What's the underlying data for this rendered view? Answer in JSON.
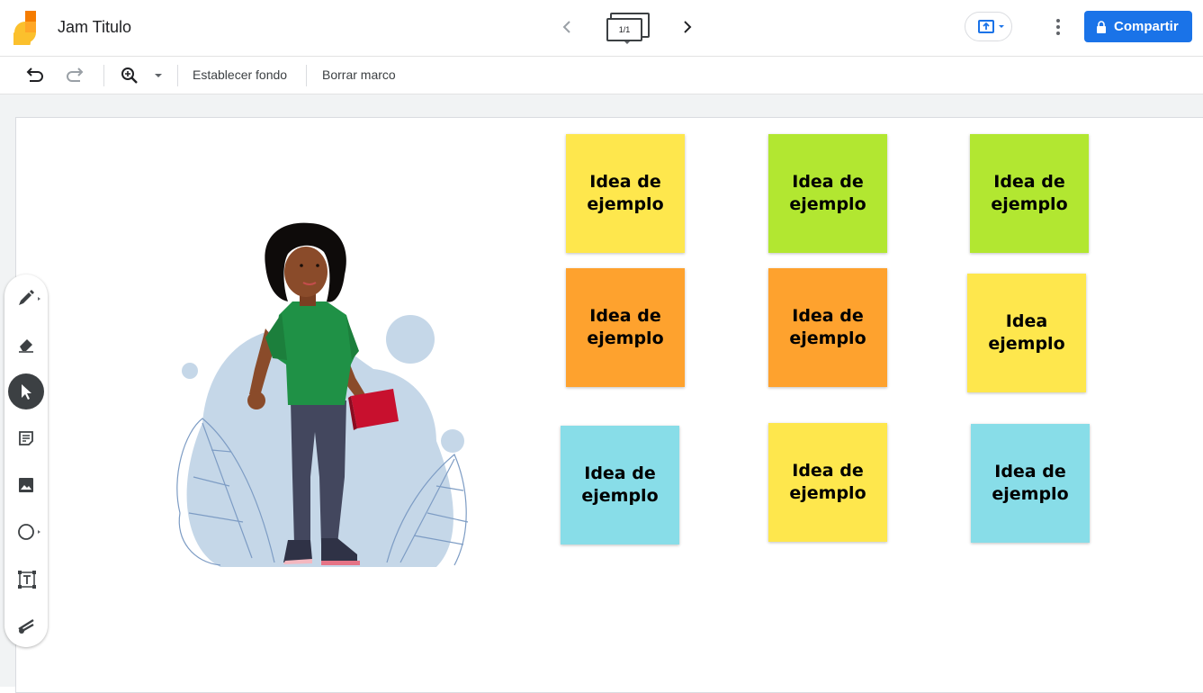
{
  "app": {
    "title": "Jam Titulo"
  },
  "nav": {
    "frame_indicator": "1/1"
  },
  "header": {
    "share_label": "Compartir"
  },
  "toolbar": {
    "set_background_label": "Establecer fondo",
    "clear_frame_label": "Borrar marco"
  },
  "side_tools": [
    "pen-icon",
    "eraser-icon",
    "select-icon",
    "sticky-note-icon",
    "image-icon",
    "circle-icon",
    "text-box-icon",
    "laser-icon"
  ],
  "colors": {
    "accent": "#1a73e8",
    "yellow": "#fee74d",
    "green": "#b2e731",
    "orange": "#fea22e",
    "cyan": "#88dde8"
  },
  "stickies": [
    {
      "text": "Idea de ejemplo",
      "color": "yellow"
    },
    {
      "text": "Idea de ejemplo",
      "color": "green"
    },
    {
      "text": "Idea de ejemplo",
      "color": "green"
    },
    {
      "text": "Idea de ejemplo",
      "color": "orange"
    },
    {
      "text": "Idea de ejemplo",
      "color": "orange"
    },
    {
      "text": "Idea ejemplo",
      "color": "yellow"
    },
    {
      "text": "Idea de ejemplo",
      "color": "cyan"
    },
    {
      "text": "Idea de ejemplo",
      "color": "yellow"
    },
    {
      "text": "Idea de ejemplo",
      "color": "cyan"
    }
  ]
}
